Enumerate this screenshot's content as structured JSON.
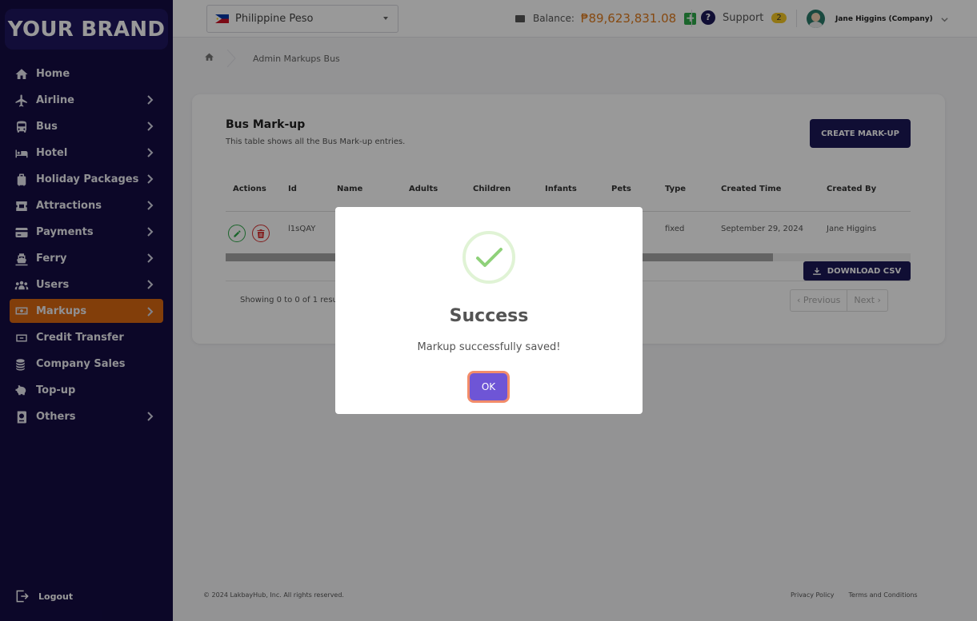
{
  "brand": {
    "name": "YOUR BRAND"
  },
  "sidebar": {
    "items": [
      {
        "label": "Home",
        "icon": "home-icon",
        "has_children": false
      },
      {
        "label": "Airline",
        "icon": "airplane-icon",
        "has_children": true
      },
      {
        "label": "Bus",
        "icon": "bus-icon",
        "has_children": true
      },
      {
        "label": "Hotel",
        "icon": "bed-icon",
        "has_children": true
      },
      {
        "label": "Holiday Packages",
        "icon": "suitcase-icon",
        "has_children": true
      },
      {
        "label": "Attractions",
        "icon": "ticket-icon",
        "has_children": true
      },
      {
        "label": "Payments",
        "icon": "credit-card-icon",
        "has_children": true
      },
      {
        "label": "Ferry",
        "icon": "ferry-icon",
        "has_children": true
      },
      {
        "label": "Users",
        "icon": "users-icon",
        "has_children": true
      },
      {
        "label": "Markups",
        "icon": "money-icon",
        "has_children": true,
        "active": true
      },
      {
        "label": "Credit Transfer",
        "icon": "transfer-icon",
        "has_children": false
      },
      {
        "label": "Company Sales",
        "icon": "coins-icon",
        "has_children": false
      },
      {
        "label": "Top-up",
        "icon": "piggy-bank-icon",
        "has_children": false
      },
      {
        "label": "Others",
        "icon": "passport-icon",
        "has_children": true
      }
    ],
    "logout_label": "Logout"
  },
  "topbar": {
    "currency": "Philippine Peso",
    "balance_label": "Balance:",
    "balance_amount": "₱89,623,831.08",
    "support_label": "Support",
    "support_count": "2",
    "user_name": "Jane Higgins (Company)"
  },
  "breadcrumb": {
    "current": "Admin Markups Bus"
  },
  "card": {
    "title": "Bus Mark-up",
    "subtitle": "This table shows all the Bus Mark-up entries.",
    "create_button": "CREATE MARK-UP",
    "columns": [
      "Actions",
      "Id",
      "Name",
      "Adults",
      "Children",
      "Infants",
      "Pets",
      "Type",
      "Created Time",
      "Created By"
    ],
    "row": {
      "id": "l1sQAY",
      "type": "fixed",
      "created_time": "September 29, 2024",
      "created_by": "Jane Higgins"
    },
    "download_button": "DOWNLOAD CSV",
    "showing_text": "Showing 0 to 0 of 1 resu",
    "pager_previous": "‹ Previous",
    "pager_next": "Next ›"
  },
  "footer": {
    "copyright": "© 2024 LakbayHub, Inc. All rights reserved.",
    "privacy": "Privacy Policy",
    "terms": "Terms and Conditions"
  },
  "modal": {
    "title": "Success",
    "message": "Markup successfully saved!",
    "ok_label": "OK"
  },
  "colors": {
    "sidebar_bg": "#140c44",
    "active_item": "#d96812",
    "primary_button": "#1c1858",
    "ok_button": "#6e55d6",
    "balance_amount": "#e07a1c"
  }
}
